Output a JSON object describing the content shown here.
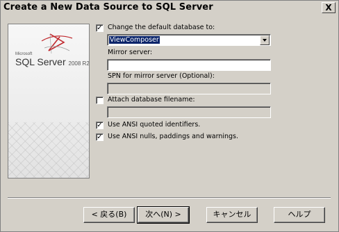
{
  "window": {
    "title": "Create a New Data Source to SQL Server",
    "close_glyph": "X"
  },
  "banner": {
    "ms_label": "Microsoft",
    "product": "SQL Server",
    "version": "2008 R2"
  },
  "form": {
    "change_db": {
      "label": "Change the default database to:",
      "checked": true,
      "value": "ViewComposer"
    },
    "mirror_server": {
      "label": "Mirror server:",
      "value": ""
    },
    "spn": {
      "label": "SPN for mirror server (Optional):",
      "value": ""
    },
    "attach_db": {
      "label": "Attach database filename:",
      "checked": false,
      "value": ""
    },
    "ansi_quoted": {
      "label": "Use ANSI quoted identifiers.",
      "checked": true
    },
    "ansi_nulls": {
      "label": "Use ANSI nulls, paddings and warnings.",
      "checked": true
    }
  },
  "buttons": {
    "back": "< 戻る(B)",
    "next": "次へ(N) >",
    "cancel": "キャンセル",
    "help": "ヘルプ"
  }
}
